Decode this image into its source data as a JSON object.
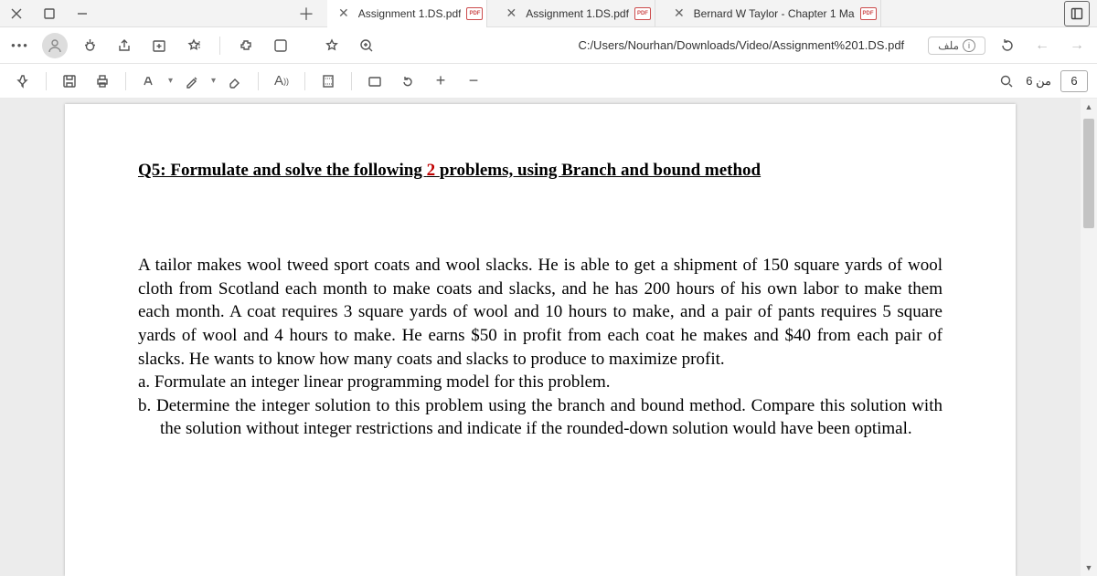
{
  "tabs": [
    {
      "title": "Assignment 1.DS.pdf"
    },
    {
      "title": "Assignment 1.DS.pdf"
    },
    {
      "title": "Bernard W Taylor - Chapter 1 Ma"
    }
  ],
  "addr": {
    "url": "C:/Users/Nourhan/Downloads/Video/Assignment%201.DS.pdf",
    "file_label": "ملف"
  },
  "pdfbar": {
    "page_prefix": "من",
    "page_total": "6",
    "page_current": "6"
  },
  "document": {
    "heading_pre": "Q5: Formulate and solve the following ",
    "heading_red": "2 ",
    "heading_post": "problems, using Branch and bound method",
    "paragraph": "A tailor makes wool tweed sport coats and wool slacks. He is able to get a shipment of 150 square yards of wool cloth from Scotland each month to make coats and slacks, and he has 200 hours of his own labor to make them each month. A coat requires 3 square yards of wool and 10 hours to make, and a pair of pants requires 5 square yards of wool and 4 hours to make. He earns $50 in profit from each coat he makes and $40 from each pair of slacks. He wants to know how many coats and slacks to produce to maximize profit.",
    "item_a": "a.  Formulate an integer linear programming model for this problem.",
    "item_b": "b.  Determine the integer solution to this problem using the branch and bound method. Compare this solution with the solution without integer restrictions and indicate if the rounded-down solution would have been optimal."
  }
}
